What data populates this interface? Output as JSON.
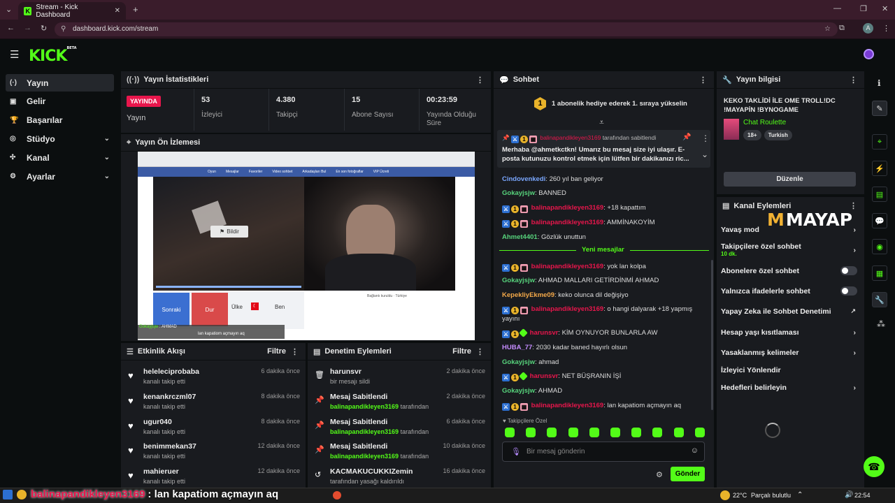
{
  "browser": {
    "tab_title": "Stream - Kick Dashboard",
    "url": "dashboard.kick.com/stream",
    "profile_initial": "A"
  },
  "header": {
    "logo": "KICK",
    "logo_badge": "BETA"
  },
  "nav": [
    {
      "label": "Yayın",
      "icon": "broadcast-icon",
      "active": true,
      "chevron": false
    },
    {
      "label": "Gelir",
      "icon": "money-icon",
      "active": false,
      "chevron": false
    },
    {
      "label": "Başarılar",
      "icon": "trophy-icon",
      "active": false,
      "chevron": false
    },
    {
      "label": "Stüdyo",
      "icon": "studio-icon",
      "active": false,
      "chevron": true
    },
    {
      "label": "Kanal",
      "icon": "channel-icon",
      "active": false,
      "chevron": true
    },
    {
      "label": "Ayarlar",
      "icon": "gear-icon",
      "active": false,
      "chevron": true
    }
  ],
  "stats": {
    "title": "Yayın İstatistikleri",
    "live_badge": "YAYINDA",
    "live_label": "Yayın",
    "items": [
      {
        "value": "53",
        "label": "İzleyici"
      },
      {
        "value": "4.380",
        "label": "Takipçi"
      },
      {
        "value": "15",
        "label": "Abone Sayısı"
      },
      {
        "value": "00:23:59",
        "label": "Yayında Olduğu Süre"
      }
    ]
  },
  "preview": {
    "title": "Yayın Ön İzlemesi",
    "report_button": "Bildir",
    "buttons": [
      "Sonraki",
      "Dur",
      "Ülke",
      "Ben"
    ],
    "overlay_user": "Gokayjsjw",
    "overlay_text": "AHMAD",
    "overlay_line2": "lan kapatiom açmayın aq",
    "video_site_tabs": [
      "Oyun",
      "Mesajlar",
      "Favoriler",
      "Video sohbet",
      "Arkadaşları Bul",
      "En son fotoğraflar",
      "VIP Ücreti"
    ],
    "connected_text": "Bağlantı kuruldu",
    "country": "Türkiye"
  },
  "activity": {
    "title": "Etkinlik Akışı",
    "filter": "Filtre",
    "items": [
      {
        "name": "heleleciprobaba",
        "sub": "kanalı takip etti",
        "time": "6 dakika önce"
      },
      {
        "name": "kenankrczml07",
        "sub": "kanalı takip etti",
        "time": "8 dakika önce"
      },
      {
        "name": "ugur040",
        "sub": "kanalı takip etti",
        "time": "8 dakika önce"
      },
      {
        "name": "benimmekan37",
        "sub": "kanalı takip etti",
        "time": "12 dakika önce"
      },
      {
        "name": "mahieruer",
        "sub": "kanalı takip etti",
        "time": "12 dakika önce"
      }
    ]
  },
  "moderation": {
    "title": "Denetim Eylemleri",
    "filter": "Filtre",
    "items": [
      {
        "icon": "trash-icon",
        "name": "harunsvr",
        "sub_pre": "",
        "sub_user": "",
        "sub": "bir mesajı sildi",
        "time": "2 dakika önce"
      },
      {
        "icon": "pin-icon",
        "name": "Mesaj Sabitlendi",
        "sub_user": "balinapandikleyen3169",
        "sub": "tarafından",
        "time": "2 dakika önce"
      },
      {
        "icon": "pin-icon",
        "name": "Mesaj Sabitlendi",
        "sub_user": "balinapandikleyen3169",
        "sub": "tarafından",
        "time": "6 dakika önce"
      },
      {
        "icon": "pin-icon",
        "name": "Mesaj Sabitlendi",
        "sub_user": "balinapandikleyen3169",
        "sub": "tarafından",
        "time": "10 dakika önce"
      },
      {
        "icon": "undo-icon",
        "name": "KACMAKUCUKKIZemin",
        "sub_user": "",
        "sub": "tarafından yasağı kaldırıldı",
        "time": "16 dakika önce"
      }
    ]
  },
  "chat": {
    "title": "Sohbet",
    "gift_count": "1",
    "gift_text": "1 abonelik hediye ederek 1. sıraya yükselin",
    "pinned_by_user": "balinapandikleyen3169",
    "pinned_by_suffix": "tarafından sabitlendi",
    "pinned_text": "Merhaba @ahmetkctkn! Umarız bu mesaj size iyi ulaşır. E-posta kutunuzu kontrol etmek için lütfen bir dakikanızı ric...",
    "new_messages": "Yeni mesajlar",
    "messages": [
      {
        "user": "Cindovenkedi",
        "color": "#7aa7ff",
        "badges": "",
        "text": "260 yıl ban geliyor"
      },
      {
        "user": "Gokayjsjw",
        "color": "#57d37c",
        "badges": "",
        "text": "BANNED"
      },
      {
        "user": "balinapandikleyen3169",
        "color": "#e8164c",
        "badges": "bgp",
        "text": "+18 kapattım"
      },
      {
        "user": "balinapandikleyen3169",
        "color": "#e8164c",
        "badges": "bgp",
        "text": "AMMİNAKOYİM"
      },
      {
        "user": "Ahmet4401",
        "color": "#57d37c",
        "badges": "",
        "text": "Gözlük unuttun"
      },
      {
        "user": "balinapandikleyen3169",
        "color": "#e8164c",
        "badges": "bgp",
        "text": "yok lan kolpa"
      },
      {
        "user": "Gokayjsjw",
        "color": "#57d37c",
        "badges": "",
        "text": "AHMAD MALLARI GETİRDİNMİ AHMAD"
      },
      {
        "user": "KepekliyEkme09",
        "color": "#f4a949",
        "badges": "",
        "text": "keko olunca dil değişiyo"
      },
      {
        "user": "balinapandikleyen3169",
        "color": "#e8164c",
        "badges": "bgp",
        "text": "o hangi dalyarak +18 yapmış yayını"
      },
      {
        "user": "harunsvr",
        "color": "#e8164c",
        "badges": "bgs",
        "text": "KİM OYNUYOR BUNLARLA AW"
      },
      {
        "user": "HUBA_77",
        "color": "#c58cff",
        "badges": "",
        "text": "2030 kadar baned hayırlı olsun"
      },
      {
        "user": "Gokayjsjw",
        "color": "#57d37c",
        "badges": "",
        "text": "ahmad"
      },
      {
        "user": "harunsvr",
        "color": "#e8164c",
        "badges": "bgs",
        "text": "NET BÜŞRANIN İŞİ"
      },
      {
        "user": "Gokayjsjw",
        "color": "#57d37c",
        "badges": "",
        "text": "AHMAD"
      },
      {
        "user": "balinapandikleyen3169",
        "color": "#e8164c",
        "badges": "bgp",
        "text": "lan kapatiom açmayın aq"
      }
    ],
    "emote_section": "Takipçilere Özel",
    "input_placeholder": "Bir mesaj gönderin",
    "send_button": "Gönder"
  },
  "info": {
    "title": "Yayın bilgisi",
    "stream_title": "KEKO TAKLİDİ İLE OME TROLL!DC !MAYAPİN !BYNOGAME",
    "category": "Chat Roulette",
    "tags": [
      "18+",
      "Turkish"
    ],
    "edit_button": "Düzenle"
  },
  "channel_actions": {
    "title": "Kanal Eylemleri",
    "watermark": "MAYAP",
    "rows": [
      {
        "label": "Yavaş mod",
        "sub": "",
        "control": "arrow"
      },
      {
        "label": "Takipçilere özel sohbet",
        "sub": "10 dk.",
        "control": "arrow"
      },
      {
        "label": "Abonelere özel sohbet",
        "sub": "",
        "control": "toggle"
      },
      {
        "label": "Yalnızca ifadelerle sohbet",
        "sub": "",
        "control": "toggle"
      },
      {
        "label": "Yapay Zeka ile Sohbet Denetimi",
        "sub": "",
        "control": "external"
      },
      {
        "label": "Hesap yaşı kısıtlaması",
        "sub": "",
        "control": "arrow"
      },
      {
        "label": "Yasaklanmış kelimeler",
        "sub": "",
        "control": "arrow"
      },
      {
        "label": "İzleyici Yönlendir",
        "sub": "",
        "control": "none"
      },
      {
        "label": "Hedefleri belirleyin",
        "sub": "",
        "control": "arrow"
      }
    ]
  },
  "overlay_bottom": {
    "user": "balinapandikleyen3169",
    "text": ": lan kapatiom açmayın aq"
  },
  "taskbar": {
    "weather": "22°C",
    "weather_text": "Parçalı bulutlu",
    "time": "22:54"
  },
  "colors": {
    "accent": "#53fc18",
    "live": "#e8164c",
    "panel": "#191b1f"
  }
}
